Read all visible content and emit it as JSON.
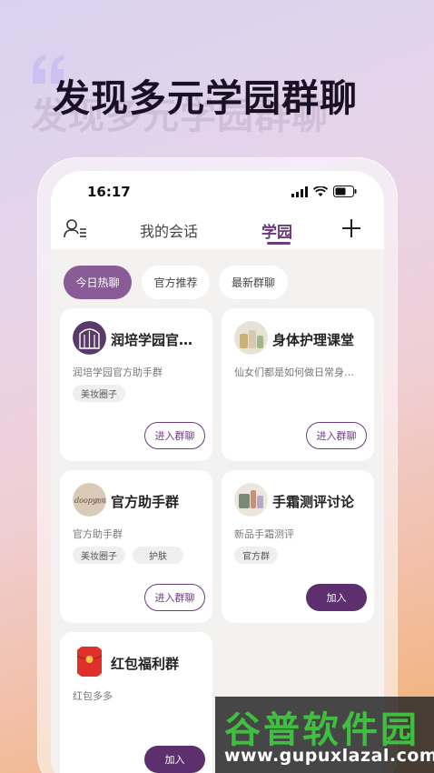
{
  "hero": {
    "title": "发现多元学园群聊"
  },
  "status_bar": {
    "time": "16:17"
  },
  "nav": {
    "tabs": [
      {
        "label": "我的会话",
        "active": false
      },
      {
        "label": "学园",
        "active": true
      }
    ],
    "left_icon": "person-list-icon",
    "right_icon": "plus-icon"
  },
  "filters": [
    {
      "label": "今日热聊",
      "active": true
    },
    {
      "label": "官方推荐",
      "active": false
    },
    {
      "label": "最新群聊",
      "active": false
    }
  ],
  "groups": [
    {
      "title": "润培学园官方助手群",
      "title_display": "润培学园官…",
      "desc": "润培学园官方助手群",
      "tags": [
        "美妆圈子"
      ],
      "button": "进入群聊",
      "button_style": "outline"
    },
    {
      "title": "身体护理课堂",
      "desc": "仙女们都是如何做日常身体护理的",
      "desc_display": "仙女们都是如何做日常身…",
      "tags": [],
      "button": "进入群聊",
      "button_style": "outline"
    },
    {
      "title": "官方助手群",
      "desc": "官方助手群",
      "tags": [
        "美妆圈子",
        "护肤"
      ],
      "button": "进入群聊",
      "button_style": "outline"
    },
    {
      "title": "手霜测评讨论",
      "desc": "新品手霜测评",
      "tags": [
        "官方群"
      ],
      "button": "加入",
      "button_style": "filled"
    },
    {
      "title": "红包福利群",
      "desc": "红包多多",
      "tags": [],
      "button": "加入",
      "button_style": "filled"
    }
  ],
  "watermark": {
    "main": "谷普软件园",
    "url": "www.gupuxlazal.com"
  },
  "colors": {
    "accent": "#6b3c7d",
    "chip_active": "#8a5c97",
    "button_filled": "#5e2f6f"
  }
}
